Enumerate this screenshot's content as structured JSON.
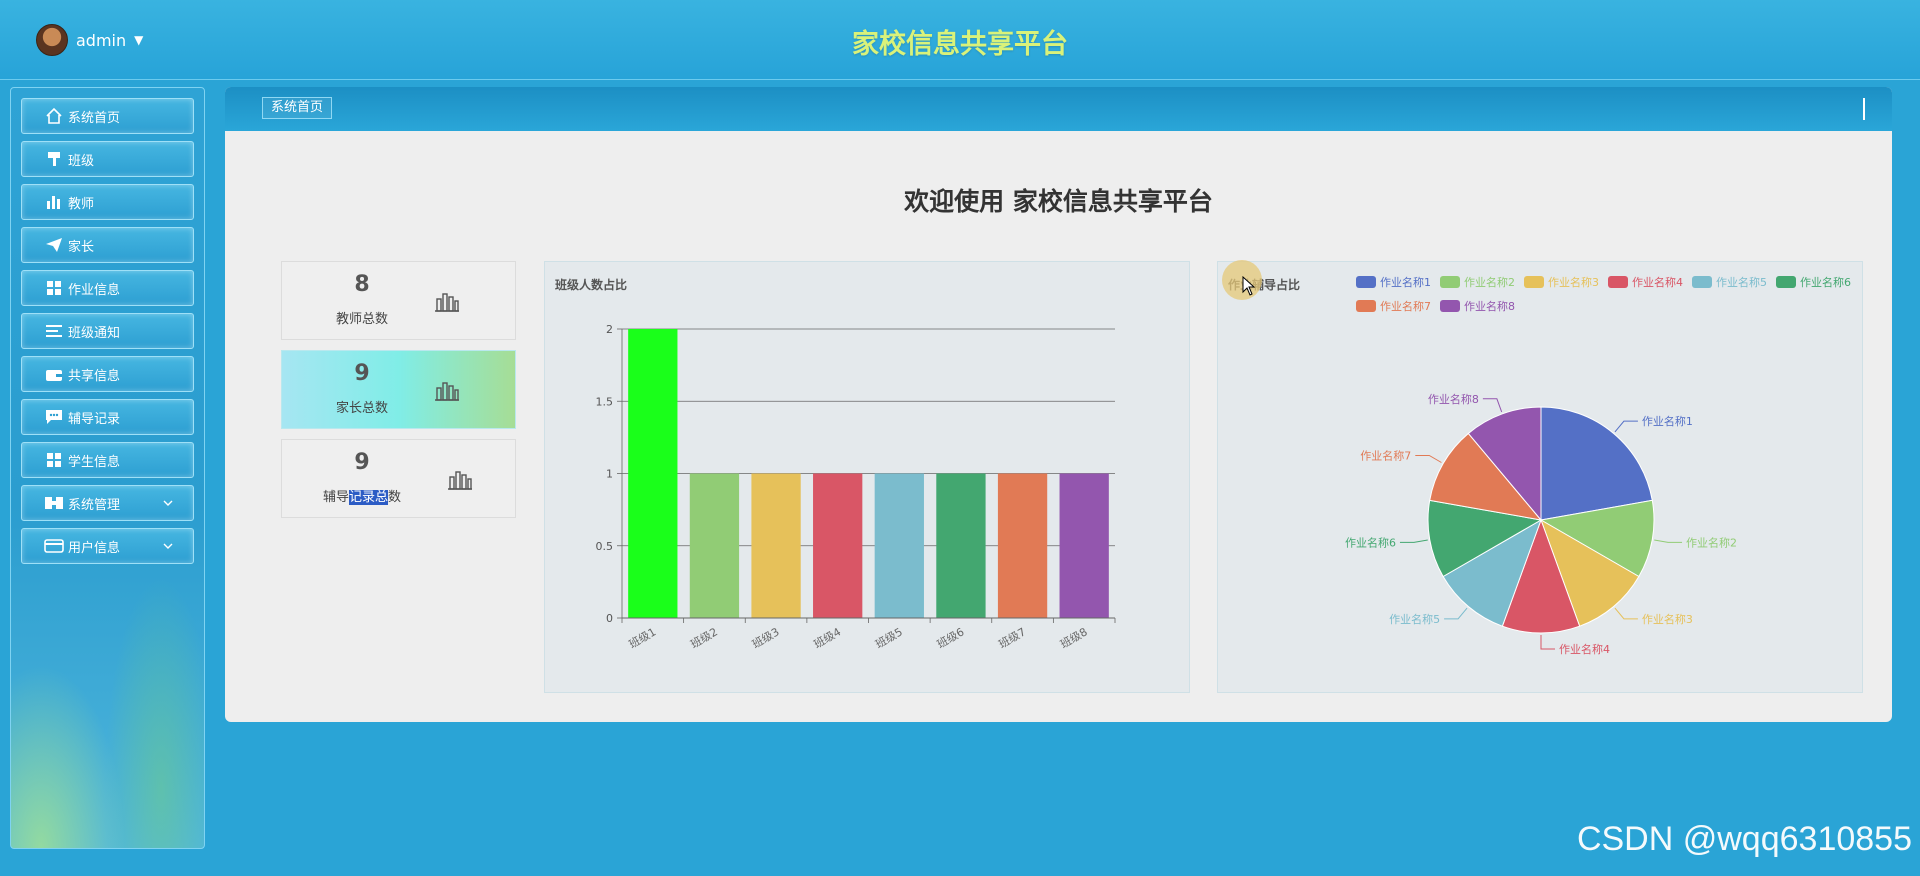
{
  "header": {
    "username": "admin",
    "app_title": "家校信息共享平台"
  },
  "sidebar": {
    "items": [
      {
        "label": "系统首页",
        "icon": "home-icon"
      },
      {
        "label": "班级",
        "icon": "paint-roller-icon"
      },
      {
        "label": "教师",
        "icon": "bar-chart-icon"
      },
      {
        "label": "家长",
        "icon": "paper-plane-icon"
      },
      {
        "label": "作业信息",
        "icon": "grid-icon"
      },
      {
        "label": "班级通知",
        "icon": "list-icon"
      },
      {
        "label": "共享信息",
        "icon": "wallet-icon"
      },
      {
        "label": "辅导记录",
        "icon": "message-icon"
      },
      {
        "label": "学生信息",
        "icon": "grid-icon"
      },
      {
        "label": "系统管理",
        "icon": "puzzle-icon",
        "expandable": true
      },
      {
        "label": "用户信息",
        "icon": "card-icon",
        "expandable": true
      }
    ]
  },
  "breadcrumb": {
    "current": "系统首页"
  },
  "welcome": "欢迎使用 家校信息共享平台",
  "stats": [
    {
      "value": "8",
      "label": "教师总数",
      "icon": "bar-chart-outline-icon"
    },
    {
      "value": "9",
      "label": "家长总数",
      "icon": "bar-chart-outline-icon",
      "highlighted": true
    },
    {
      "value": "9",
      "label_before": "辅导",
      "label_selected": "记录总",
      "label_after": "数",
      "icon": "bar-chart-outline-icon"
    }
  ],
  "bar_panel_title": "班级人数占比",
  "pie_panel_title": "作业辅导占比",
  "watermark": "CSDN @wqq6310855",
  "chart_data": [
    {
      "type": "bar",
      "title": "班级人数占比",
      "categories": [
        "班级1",
        "班级2",
        "班级3",
        "班级4",
        "班级5",
        "班级6",
        "班级7",
        "班级8"
      ],
      "values": [
        2,
        1,
        1,
        1,
        1,
        1,
        1,
        1
      ],
      "colors": [
        "#1aff1a",
        "#91cc75",
        "#e6c15a",
        "#d95666",
        "#7bbccd",
        "#43a770",
        "#e17a55",
        "#9356ae"
      ],
      "ylim": [
        0,
        2
      ],
      "yticks": [
        0,
        0.5,
        1,
        1.5,
        2
      ],
      "ytick_labels": [
        "0",
        "0.5",
        "1",
        "1.5",
        "2"
      ],
      "grid": true
    },
    {
      "type": "pie",
      "title": "作业辅导占比",
      "legend_position": "top",
      "categories": [
        "作业名称1",
        "作业名称2",
        "作业名称3",
        "作业名称4",
        "作业名称5",
        "作业名称6",
        "作业名称7",
        "作业名称8"
      ],
      "values": [
        2,
        1,
        1,
        1,
        1,
        1,
        1,
        1
      ],
      "colors": [
        "#5470c6",
        "#91cc75",
        "#e6c15a",
        "#d95666",
        "#7bbccd",
        "#43a770",
        "#e17a55",
        "#9356ae"
      ]
    }
  ]
}
